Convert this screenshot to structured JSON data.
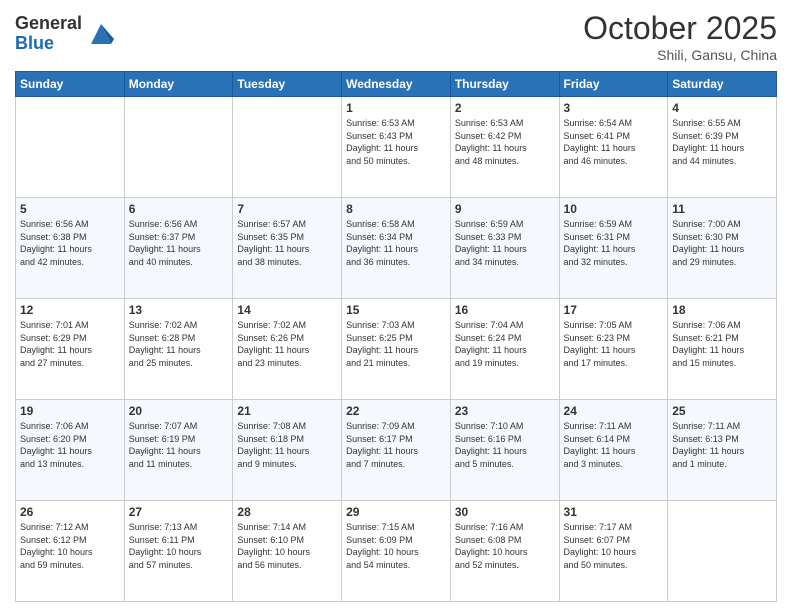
{
  "header": {
    "logo_general": "General",
    "logo_blue": "Blue",
    "month": "October 2025",
    "location": "Shili, Gansu, China"
  },
  "days_of_week": [
    "Sunday",
    "Monday",
    "Tuesday",
    "Wednesday",
    "Thursday",
    "Friday",
    "Saturday"
  ],
  "weeks": [
    [
      {
        "day": "",
        "info": ""
      },
      {
        "day": "",
        "info": ""
      },
      {
        "day": "",
        "info": ""
      },
      {
        "day": "1",
        "info": "Sunrise: 6:53 AM\nSunset: 6:43 PM\nDaylight: 11 hours\nand 50 minutes."
      },
      {
        "day": "2",
        "info": "Sunrise: 6:53 AM\nSunset: 6:42 PM\nDaylight: 11 hours\nand 48 minutes."
      },
      {
        "day": "3",
        "info": "Sunrise: 6:54 AM\nSunset: 6:41 PM\nDaylight: 11 hours\nand 46 minutes."
      },
      {
        "day": "4",
        "info": "Sunrise: 6:55 AM\nSunset: 6:39 PM\nDaylight: 11 hours\nand 44 minutes."
      }
    ],
    [
      {
        "day": "5",
        "info": "Sunrise: 6:56 AM\nSunset: 6:38 PM\nDaylight: 11 hours\nand 42 minutes."
      },
      {
        "day": "6",
        "info": "Sunrise: 6:56 AM\nSunset: 6:37 PM\nDaylight: 11 hours\nand 40 minutes."
      },
      {
        "day": "7",
        "info": "Sunrise: 6:57 AM\nSunset: 6:35 PM\nDaylight: 11 hours\nand 38 minutes."
      },
      {
        "day": "8",
        "info": "Sunrise: 6:58 AM\nSunset: 6:34 PM\nDaylight: 11 hours\nand 36 minutes."
      },
      {
        "day": "9",
        "info": "Sunrise: 6:59 AM\nSunset: 6:33 PM\nDaylight: 11 hours\nand 34 minutes."
      },
      {
        "day": "10",
        "info": "Sunrise: 6:59 AM\nSunset: 6:31 PM\nDaylight: 11 hours\nand 32 minutes."
      },
      {
        "day": "11",
        "info": "Sunrise: 7:00 AM\nSunset: 6:30 PM\nDaylight: 11 hours\nand 29 minutes."
      }
    ],
    [
      {
        "day": "12",
        "info": "Sunrise: 7:01 AM\nSunset: 6:29 PM\nDaylight: 11 hours\nand 27 minutes."
      },
      {
        "day": "13",
        "info": "Sunrise: 7:02 AM\nSunset: 6:28 PM\nDaylight: 11 hours\nand 25 minutes."
      },
      {
        "day": "14",
        "info": "Sunrise: 7:02 AM\nSunset: 6:26 PM\nDaylight: 11 hours\nand 23 minutes."
      },
      {
        "day": "15",
        "info": "Sunrise: 7:03 AM\nSunset: 6:25 PM\nDaylight: 11 hours\nand 21 minutes."
      },
      {
        "day": "16",
        "info": "Sunrise: 7:04 AM\nSunset: 6:24 PM\nDaylight: 11 hours\nand 19 minutes."
      },
      {
        "day": "17",
        "info": "Sunrise: 7:05 AM\nSunset: 6:23 PM\nDaylight: 11 hours\nand 17 minutes."
      },
      {
        "day": "18",
        "info": "Sunrise: 7:06 AM\nSunset: 6:21 PM\nDaylight: 11 hours\nand 15 minutes."
      }
    ],
    [
      {
        "day": "19",
        "info": "Sunrise: 7:06 AM\nSunset: 6:20 PM\nDaylight: 11 hours\nand 13 minutes."
      },
      {
        "day": "20",
        "info": "Sunrise: 7:07 AM\nSunset: 6:19 PM\nDaylight: 11 hours\nand 11 minutes."
      },
      {
        "day": "21",
        "info": "Sunrise: 7:08 AM\nSunset: 6:18 PM\nDaylight: 11 hours\nand 9 minutes."
      },
      {
        "day": "22",
        "info": "Sunrise: 7:09 AM\nSunset: 6:17 PM\nDaylight: 11 hours\nand 7 minutes."
      },
      {
        "day": "23",
        "info": "Sunrise: 7:10 AM\nSunset: 6:16 PM\nDaylight: 11 hours\nand 5 minutes."
      },
      {
        "day": "24",
        "info": "Sunrise: 7:11 AM\nSunset: 6:14 PM\nDaylight: 11 hours\nand 3 minutes."
      },
      {
        "day": "25",
        "info": "Sunrise: 7:11 AM\nSunset: 6:13 PM\nDaylight: 11 hours\nand 1 minute."
      }
    ],
    [
      {
        "day": "26",
        "info": "Sunrise: 7:12 AM\nSunset: 6:12 PM\nDaylight: 10 hours\nand 59 minutes."
      },
      {
        "day": "27",
        "info": "Sunrise: 7:13 AM\nSunset: 6:11 PM\nDaylight: 10 hours\nand 57 minutes."
      },
      {
        "day": "28",
        "info": "Sunrise: 7:14 AM\nSunset: 6:10 PM\nDaylight: 10 hours\nand 56 minutes."
      },
      {
        "day": "29",
        "info": "Sunrise: 7:15 AM\nSunset: 6:09 PM\nDaylight: 10 hours\nand 54 minutes."
      },
      {
        "day": "30",
        "info": "Sunrise: 7:16 AM\nSunset: 6:08 PM\nDaylight: 10 hours\nand 52 minutes."
      },
      {
        "day": "31",
        "info": "Sunrise: 7:17 AM\nSunset: 6:07 PM\nDaylight: 10 hours\nand 50 minutes."
      },
      {
        "day": "",
        "info": ""
      }
    ]
  ]
}
